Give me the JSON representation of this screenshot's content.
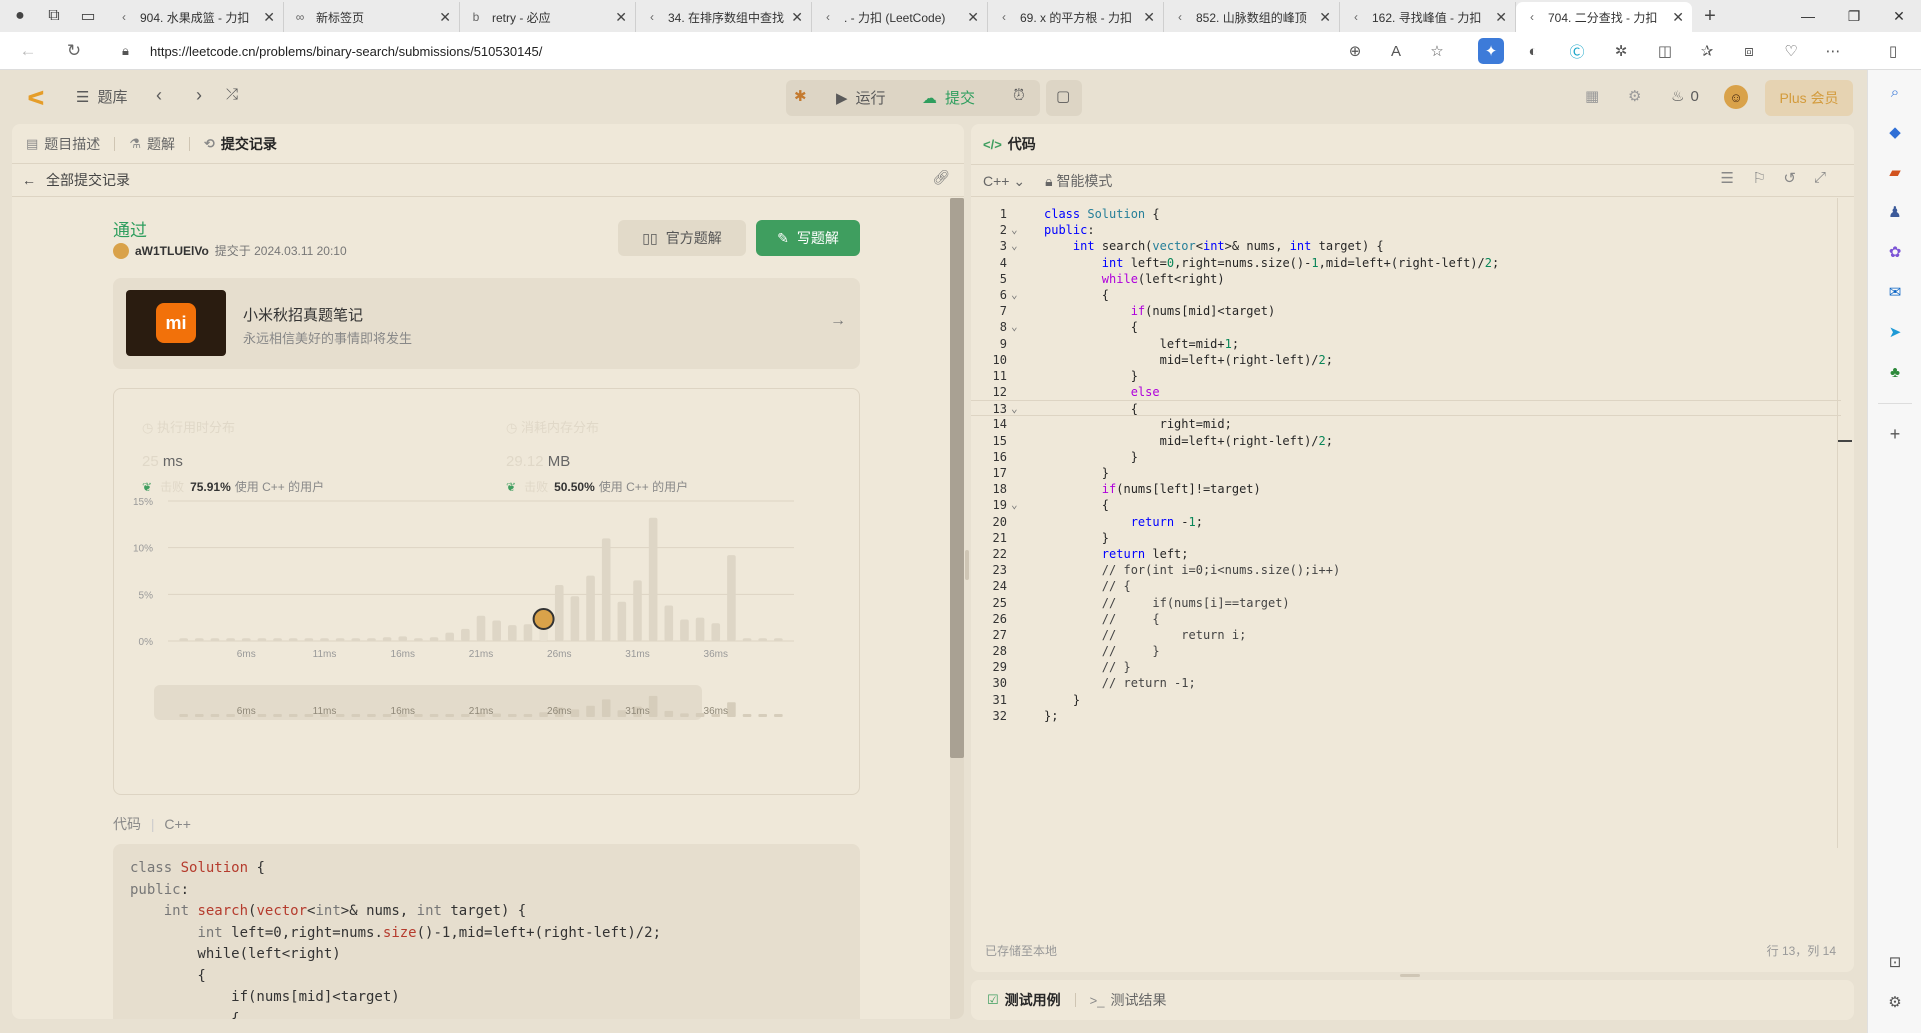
{
  "browser": {
    "tabs": [
      {
        "title": "904. 水果成篮 - 力扣",
        "icon": "leetcode-icon",
        "active": false
      },
      {
        "title": "新标签页",
        "icon": "newtab-icon",
        "active": false
      },
      {
        "title": "retry - 必应",
        "icon": "bing-icon",
        "active": false
      },
      {
        "title": "34. 在排序数组中查找",
        "icon": "leetcode-icon",
        "active": false
      },
      {
        "title": ". - 力扣 (LeetCode)",
        "icon": "leetcode-icon",
        "active": false
      },
      {
        "title": "69. x 的平方根 - 力扣",
        "icon": "leetcode-icon",
        "active": false
      },
      {
        "title": "852. 山脉数组的峰顶",
        "icon": "leetcode-icon",
        "active": false
      },
      {
        "title": "162. 寻找峰值 - 力扣",
        "icon": "leetcode-icon",
        "active": false
      },
      {
        "title": "704. 二分查找 - 力扣",
        "icon": "leetcode-icon",
        "active": true
      }
    ],
    "url": "https://leetcode.cn/problems/binary-search/submissions/510530145/"
  },
  "header": {
    "problem_list": "题库",
    "run_label": "运行",
    "submit_label": "提交",
    "streak_count": "0",
    "plus_label": "Plus 会员"
  },
  "left_panel": {
    "tabs": [
      "题目描述",
      "题解",
      "提交记录"
    ],
    "back_label": "全部提交记录",
    "status": "通过",
    "author": "aW1TLUElVo",
    "submitted_at": "提交于 2024.03.11 20:10",
    "official_solution_btn": "官方题解",
    "write_solution_btn": "写题解",
    "promo": {
      "title": "小米秋招真题笔记",
      "subtitle": "永远相信美好的事情即将发生",
      "logo_text": "mi"
    },
    "runtime": {
      "label": "执行用时分布",
      "value": "25",
      "unit": "ms",
      "beats_prefix": "击败",
      "beats": "75.91%",
      "beats_suffix": "使用 C++ 的用户"
    },
    "memory": {
      "label": "消耗内存分布",
      "value": "29.12",
      "unit": "MB",
      "beats_prefix": "击败",
      "beats": "50.50%",
      "beats_suffix": "使用 C++ 的用户"
    },
    "code_label": "代码",
    "code_lang": "C++"
  },
  "chart_data": {
    "type": "bar",
    "title": "",
    "xlabel": "",
    "ylabel": "",
    "yticks": [
      "15%",
      "10%",
      "5%",
      "0%"
    ],
    "ylim": [
      0,
      15
    ],
    "xticks": [
      "6ms",
      "11ms",
      "16ms",
      "21ms",
      "26ms",
      "31ms",
      "36ms"
    ],
    "x": [
      2,
      3,
      4,
      5,
      6,
      7,
      8,
      9,
      10,
      11,
      12,
      13,
      14,
      15,
      16,
      17,
      18,
      19,
      20,
      21,
      22,
      23,
      24,
      25,
      26,
      27,
      28,
      29,
      30,
      31,
      32,
      33,
      34,
      35,
      36,
      37,
      38,
      39,
      40
    ],
    "values": [
      0.3,
      0.3,
      0.3,
      0.3,
      0.3,
      0.3,
      0.3,
      0.3,
      0.3,
      0.3,
      0.3,
      0.3,
      0.3,
      0.4,
      0.5,
      0.3,
      0.4,
      0.9,
      1.3,
      2.7,
      2.2,
      1.7,
      1.8,
      3.0,
      6.0,
      4.8,
      7.0,
      11.0,
      4.2,
      6.5,
      13.2,
      3.8,
      2.3,
      2.5,
      1.9,
      9.2,
      0.3,
      0.3,
      0.3
    ],
    "highlight_x": 25,
    "grid": true
  },
  "left_code": [
    "class Solution {",
    "public:",
    "    int search(vector<int>& nums, int target) {",
    "        int left=0,right=nums.size()-1,mid=left+(right-left)/2;",
    "        while(left<right)",
    "        {",
    "            if(nums[mid]<target)",
    "            {"
  ],
  "right_panel": {
    "title": "代码",
    "lang": "C++",
    "mode": "智能模式",
    "saved": "已存储至本地",
    "cursor": "行 13，列 14",
    "bottom_tabs": [
      "测试用例",
      "测试结果"
    ]
  },
  "editor_lines": [
    "class Solution {",
    "public:",
    "    int search(vector<int>& nums, int target) {",
    "        int left=0,right=nums.size()-1,mid=left+(right-left)/2;",
    "        while(left<right)",
    "        {",
    "            if(nums[mid]<target)",
    "            {",
    "                left=mid+1;",
    "                mid=left+(right-left)/2;",
    "            }",
    "            else",
    "            {",
    "                right=mid;",
    "                mid=left+(right-left)/2;",
    "            }",
    "        }",
    "        if(nums[left]!=target)",
    "        {",
    "            return -1;",
    "        }",
    "        return left;",
    "        // for(int i=0;i<nums.size();i++)",
    "        // {",
    "        //     if(nums[i]==target)",
    "        //     {",
    "        //         return i;",
    "        //     }",
    "        // }",
    "        // return -1;",
    "    }",
    "};"
  ]
}
